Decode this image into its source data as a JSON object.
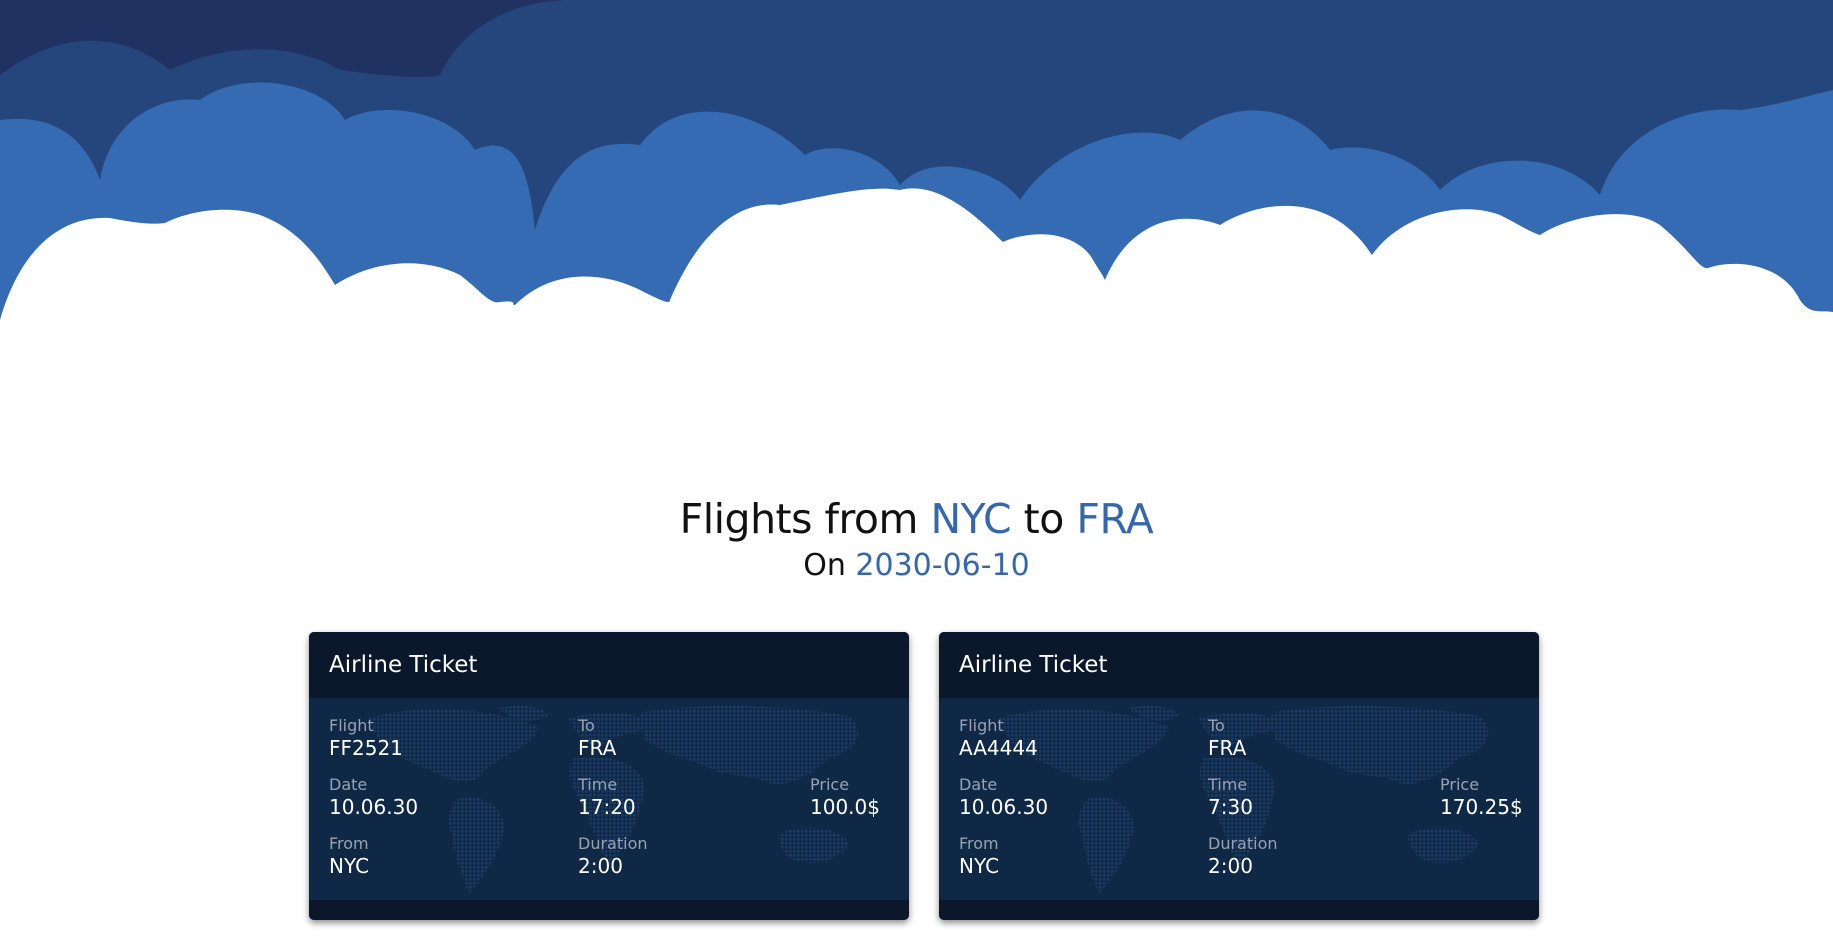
{
  "search": {
    "title_prefix": "Flights from",
    "origin": "NYC",
    "title_mid": "to",
    "destination": "FRA",
    "date_prefix": "On",
    "date": "2030-06-10"
  },
  "colors": {
    "accent": "#3567af",
    "sky_dark": "#1f3262",
    "sky_mid": "#24467c",
    "sky_light": "#356bb2",
    "ticket_header": "#0b182b",
    "ticket_body": "#0f2846"
  },
  "tickets": [
    {
      "header": "Airline Ticket",
      "labels": {
        "flight": "Flight",
        "to": "To",
        "date": "Date",
        "time": "Time",
        "price": "Price",
        "from": "From",
        "duration": "Duration"
      },
      "flight": "FF2521",
      "to": "FRA",
      "date": "10.06.30",
      "time": "17:20",
      "price": "100.0$",
      "from": "NYC",
      "duration": "2:00"
    },
    {
      "header": "Airline Ticket",
      "labels": {
        "flight": "Flight",
        "to": "To",
        "date": "Date",
        "time": "Time",
        "price": "Price",
        "from": "From",
        "duration": "Duration"
      },
      "flight": "AA4444",
      "to": "FRA",
      "date": "10.06.30",
      "time": "7:30",
      "price": "170.25$",
      "from": "NYC",
      "duration": "2:00"
    }
  ]
}
